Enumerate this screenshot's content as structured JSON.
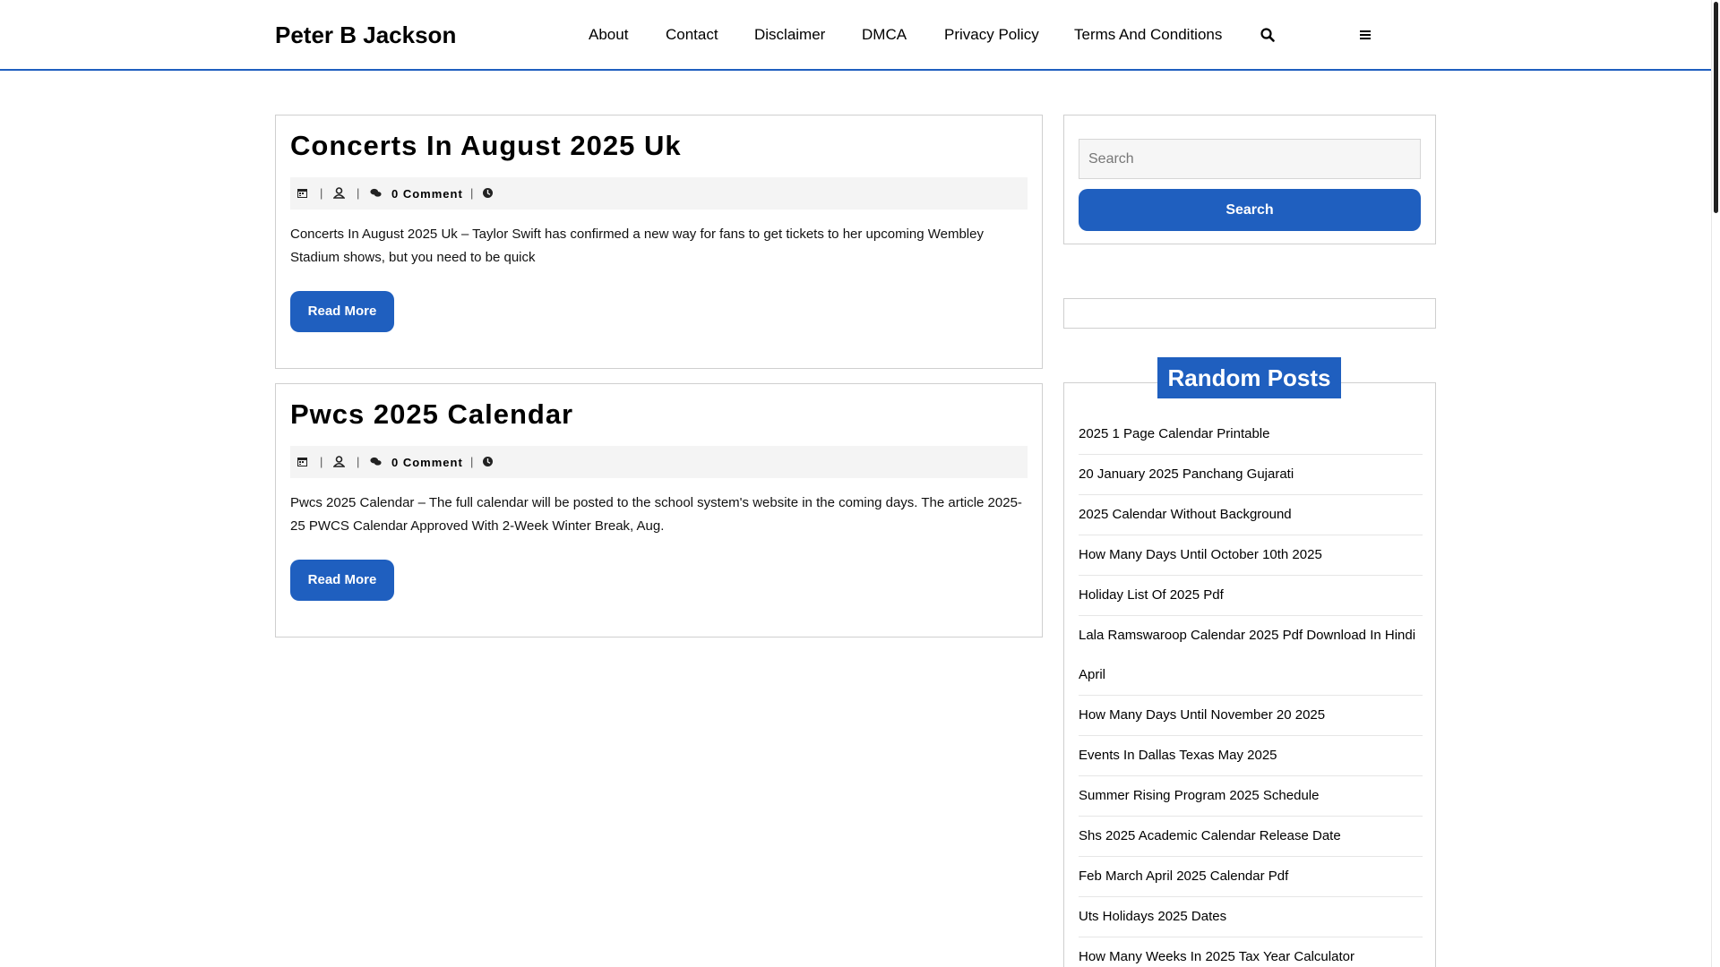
{
  "header": {
    "site_title": "Peter B Jackson",
    "nav": [
      "About",
      "Contact",
      "Disclaimer",
      "DMCA",
      "Privacy Policy",
      "Terms And Conditions"
    ],
    "accent_color": "#1f5fbf"
  },
  "posts": [
    {
      "title": "Concerts In August 2025 Uk",
      "comments": "0 Comment",
      "excerpt": "Concerts In August 2025 Uk – Taylor Swift has confirmed a new way for fans to get tickets to her upcoming Wembley Stadium shows, but you need to be quick",
      "read_more": "Read More"
    },
    {
      "title": "Pwcs 2025 Calendar",
      "comments": "0 Comment",
      "excerpt": "Pwcs 2025 Calendar – The full calendar will be posted to the school system's website in the coming days. The article 2025-25 PWCS Calendar Approved With 2-Week Winter Break, Aug.",
      "read_more": "Read More"
    }
  ],
  "sidebar": {
    "search_placeholder": "Search",
    "search_button": "Search",
    "random_heading": "Random Posts",
    "random_posts": [
      "2025 1 Page Calendar Printable",
      "20 January 2025 Panchang Gujarati",
      "2025 Calendar Without Background",
      "How Many Days Until October 10th 2025",
      "Holiday List Of 2025 Pdf",
      "Lala Ramswaroop Calendar 2025 Pdf Download In Hindi April",
      "How Many Days Until November 20 2025",
      "Events In Dallas Texas May 2025",
      "Summer Rising Program 2025 Schedule",
      "Shs 2025 Academic Calendar Release Date",
      "Feb March April 2025 Calendar Pdf",
      "Uts Holidays 2025 Dates",
      "How Many Weeks In 2025 Tax Year Calculator"
    ]
  }
}
